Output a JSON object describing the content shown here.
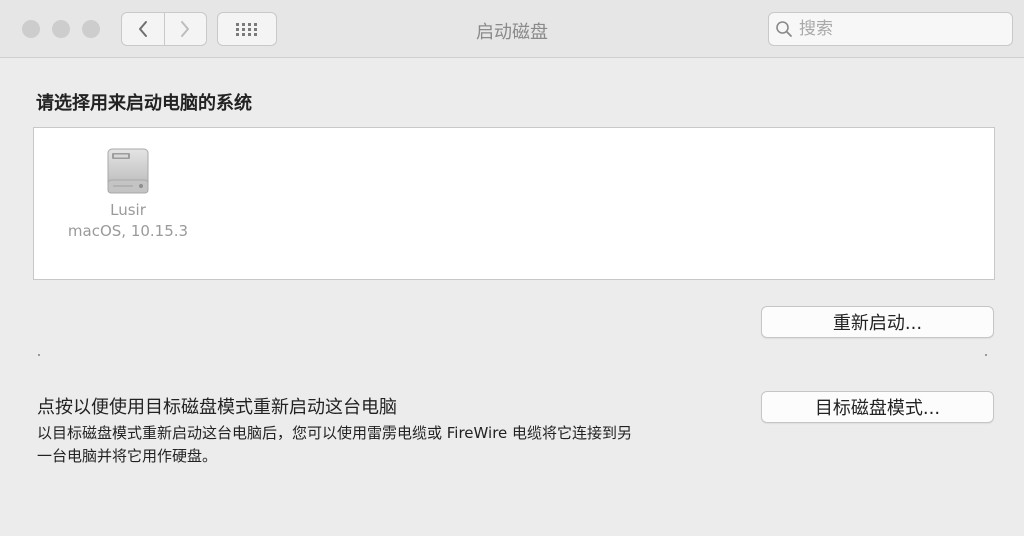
{
  "window": {
    "title": "启动磁盘",
    "search_placeholder": "搜索"
  },
  "icons": {
    "back": "chevron-left-icon",
    "forward": "chevron-right-icon",
    "grid": "grid-icon",
    "search": "search-icon",
    "disk": "hard-disk-icon"
  },
  "main": {
    "heading": "请选择用来启动电脑的系统",
    "disks": [
      {
        "name": "Lusir",
        "os": "macOS, 10.15.3"
      }
    ],
    "restart_button": "重新启动...",
    "target_mode": {
      "title": "点按以便使用目标磁盘模式重新启动这台电脑",
      "description": "以目标磁盘模式重新启动这台电脑后，您可以使用雷雳电缆或 FireWire 电缆将它连接到另一台电脑并将它用作硬盘。",
      "button": "目标磁盘模式..."
    }
  }
}
